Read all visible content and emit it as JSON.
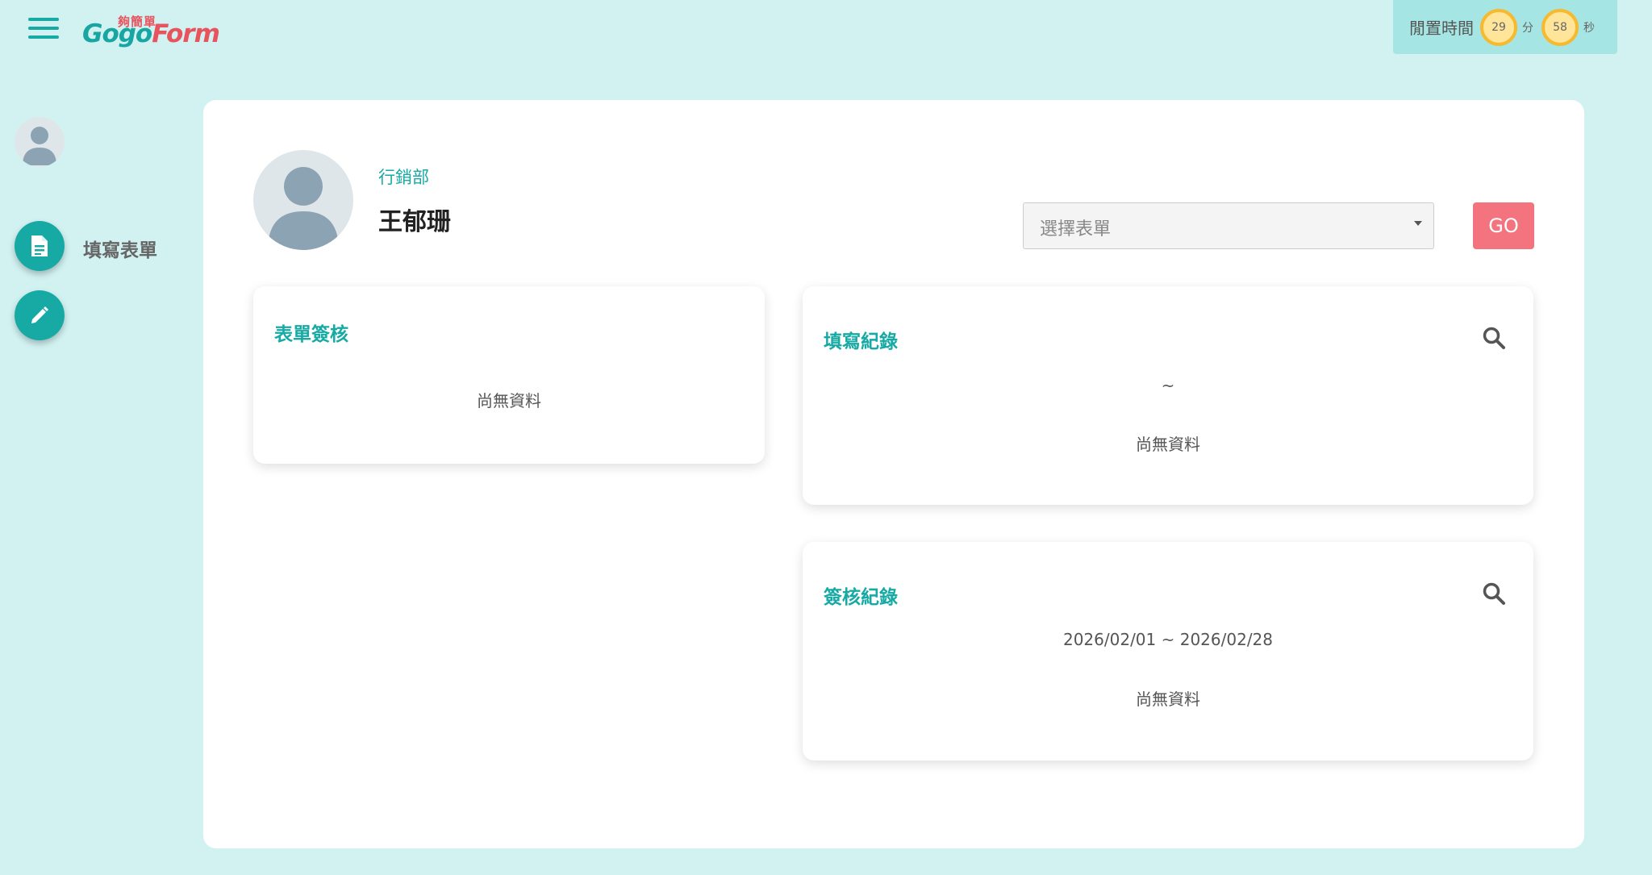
{
  "header": {
    "logo_small": "夠簡單",
    "logo_part_go": "Gogo",
    "logo_part_form": "Form",
    "idle_label": "閒置時間",
    "idle_minutes": "29",
    "minutes_unit": "分",
    "idle_seconds": "58",
    "seconds_unit": "秒"
  },
  "sidebar": {
    "fill_form_label": "填寫表單"
  },
  "profile": {
    "department": "行銷部",
    "name": "王郁珊"
  },
  "form_picker": {
    "placeholder": "選擇表單",
    "go_label": "GO"
  },
  "cards": {
    "approval": {
      "title": "表單簽核",
      "empty": "尚無資料"
    },
    "fill_records": {
      "title": "填寫紀錄",
      "range": "~",
      "empty": "尚無資料"
    },
    "sign_records": {
      "title": "簽核紀錄",
      "range": "2026/02/01 ~ 2026/02/28",
      "empty": "尚無資料"
    }
  },
  "colors": {
    "background": "#d2f2f2",
    "accent": "#17aaa5",
    "go_button": "#f3747f",
    "idle_box": "#a5e5e3",
    "timer_ring": "#f7b92d"
  },
  "icons": {
    "menu": "hamburger-icon",
    "fill_form": "document-icon",
    "edit": "pencil-icon",
    "search": "search-icon",
    "avatar": "user-avatar-icon"
  }
}
